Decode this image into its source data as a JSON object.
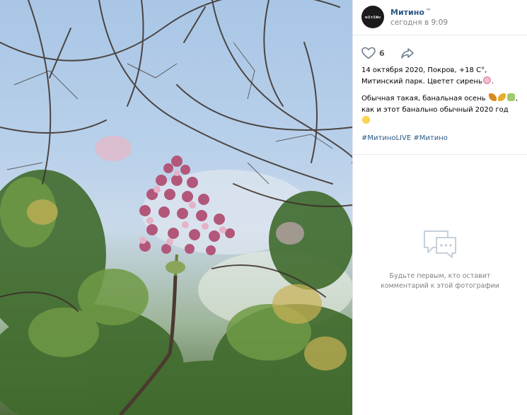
{
  "author": {
    "name": "Митино",
    "name_suffix": "™",
    "time": "сегодня в 9:09",
    "avatar_text": "ᴍɪᴛɪɴᴏ"
  },
  "actions": {
    "likes": "6",
    "like_icon": "heart-icon",
    "share_icon": "share-arrow-icon"
  },
  "description": {
    "line1": "14 октября 2020, Покров, +18 С°, Митинский парк. Цветет сирень",
    "line1_end": ".",
    "line2a": "Обычная такая, банальная осень",
    "line2b": ", как и этот банально обычный 2020 год"
  },
  "hashtags": [
    "#МитиноLIVE",
    "#Митино"
  ],
  "comments": {
    "icon": "chat-bubbles-icon",
    "empty_text": "Будьте первым, кто оставит комментарий к этой фотографии"
  },
  "colors": {
    "link": "#2a5885",
    "muted": "#828282",
    "divider": "#e7e8ec"
  }
}
